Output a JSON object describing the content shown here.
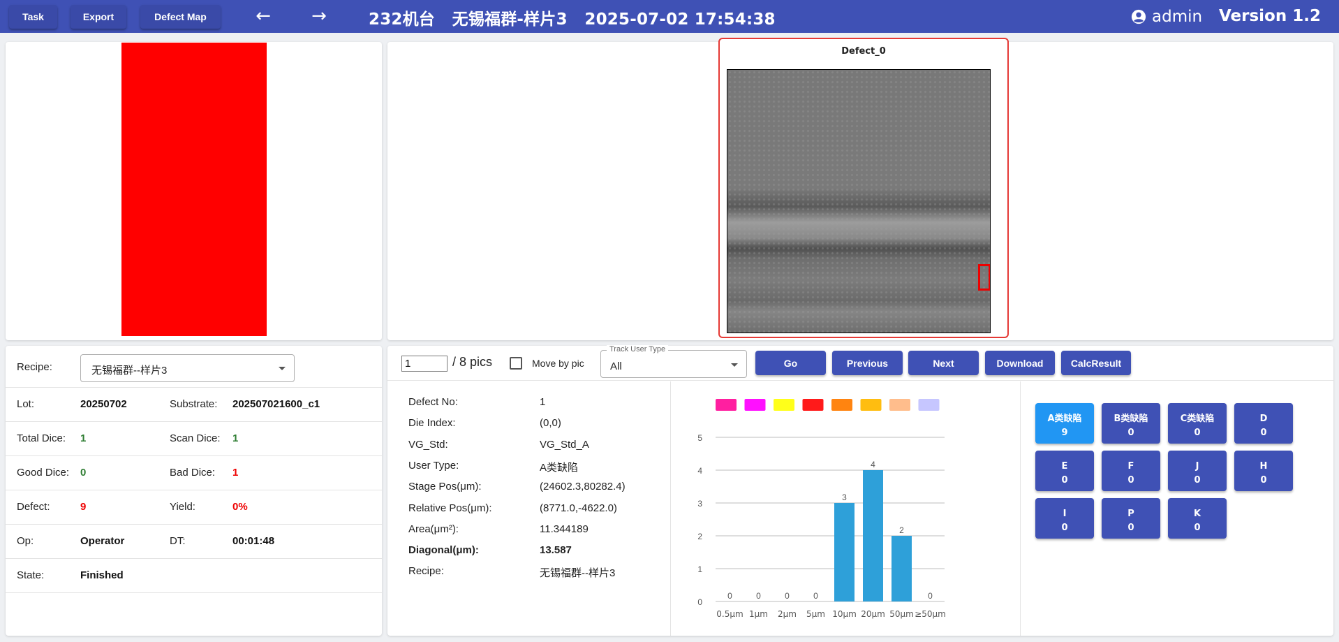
{
  "toolbar": {
    "task_label": "Task",
    "export_label": "Export",
    "defect_map_label": "Defect Map",
    "back_icon": "←",
    "forward_icon": "→",
    "title": "232机台   无锡福群-样片3   2025-07-02 17:54:38",
    "user": "admin",
    "version": "Version 1.2"
  },
  "colors": {
    "header": "#3f51b5",
    "map_fill": "#ff0000",
    "bar": "#2ea0d9",
    "active_type": "#2196f3"
  },
  "defect_view": {
    "title": "Defect_0"
  },
  "info": {
    "recipe_label": "Recipe:",
    "recipe_value": "无锡福群--样片3",
    "rows": [
      {
        "l1": "Lot:",
        "v1": "20250702",
        "l2": "Substrate:",
        "v2": "202507021600_c1"
      },
      {
        "l1": "Total Dice:",
        "v1": "1",
        "l2": "Scan Dice:",
        "v2": "1"
      },
      {
        "l1": "Good Dice:",
        "v1": "0",
        "l2": "Bad Dice:",
        "v2": "1"
      },
      {
        "l1": "Defect:",
        "v1": "9",
        "l2": "Yield:",
        "v2": "0%"
      },
      {
        "l1": "Op:",
        "v1": "Operator",
        "l2": "DT:",
        "v2": "00:01:48"
      },
      {
        "l1": "State:",
        "v1": "Finished",
        "l2": "",
        "v2": ""
      }
    ]
  },
  "controls": {
    "page_value": "1",
    "pics_text": "/ 8 pics",
    "move_by_pic": "Move by pic",
    "track_legend": "Track User Type",
    "track_value": "All",
    "go": "Go",
    "previous": "Previous",
    "next": "Next",
    "download": "Download",
    "calc": "CalcResult"
  },
  "details": [
    {
      "label": "Defect No:",
      "value": "1",
      "bold": false
    },
    {
      "label": "Die Index:",
      "value": "(0,0)",
      "bold": false
    },
    {
      "label": "VG_Std:",
      "value": "VG_Std_A",
      "bold": false
    },
    {
      "label": "User Type:",
      "value": "A类缺陷",
      "bold": false
    },
    {
      "label": "Stage Pos(μm):",
      "value": "(24602.3,80282.4)",
      "bold": false
    },
    {
      "label": "Relative Pos(μm):",
      "value": "(8771.0,-4622.0)",
      "bold": false
    },
    {
      "label": "Area(μm²):",
      "value": "11.344189",
      "bold": false
    },
    {
      "label": "Diagonal(μm):",
      "value": "13.587",
      "bold": true
    },
    {
      "label": "Recipe:",
      "value": "无锡福群--样片3",
      "bold": false
    }
  ],
  "chart_data": {
    "type": "bar",
    "categories": [
      "0.5μm",
      "1μm",
      "2μm",
      "5μm",
      "10μm",
      "20μm",
      "50μm",
      "≥50μm"
    ],
    "values": [
      0,
      0,
      0,
      0,
      3,
      4,
      2,
      0
    ],
    "ylim": [
      0,
      5
    ],
    "yticks": [
      0,
      1,
      2,
      3,
      4,
      5
    ],
    "grid": true,
    "legend_swatches": [
      "#ff1fa0",
      "#ff10ff",
      "#ffff1a",
      "#ff1a1a",
      "#ff8410",
      "#ffbd10",
      "#ffbd8c",
      "#c6c6ff"
    ]
  },
  "defect_types": [
    {
      "name": "A类缺陷",
      "count": "9",
      "active": true
    },
    {
      "name": "B类缺陷",
      "count": "0",
      "active": false
    },
    {
      "name": "C类缺陷",
      "count": "0",
      "active": false
    },
    {
      "name": "D",
      "count": "0",
      "active": false
    },
    {
      "name": "E",
      "count": "0",
      "active": false
    },
    {
      "name": "F",
      "count": "0",
      "active": false
    },
    {
      "name": "J",
      "count": "0",
      "active": false
    },
    {
      "name": "H",
      "count": "0",
      "active": false
    },
    {
      "name": "I",
      "count": "0",
      "active": false
    },
    {
      "name": "P",
      "count": "0",
      "active": false
    },
    {
      "name": "K",
      "count": "0",
      "active": false
    }
  ]
}
